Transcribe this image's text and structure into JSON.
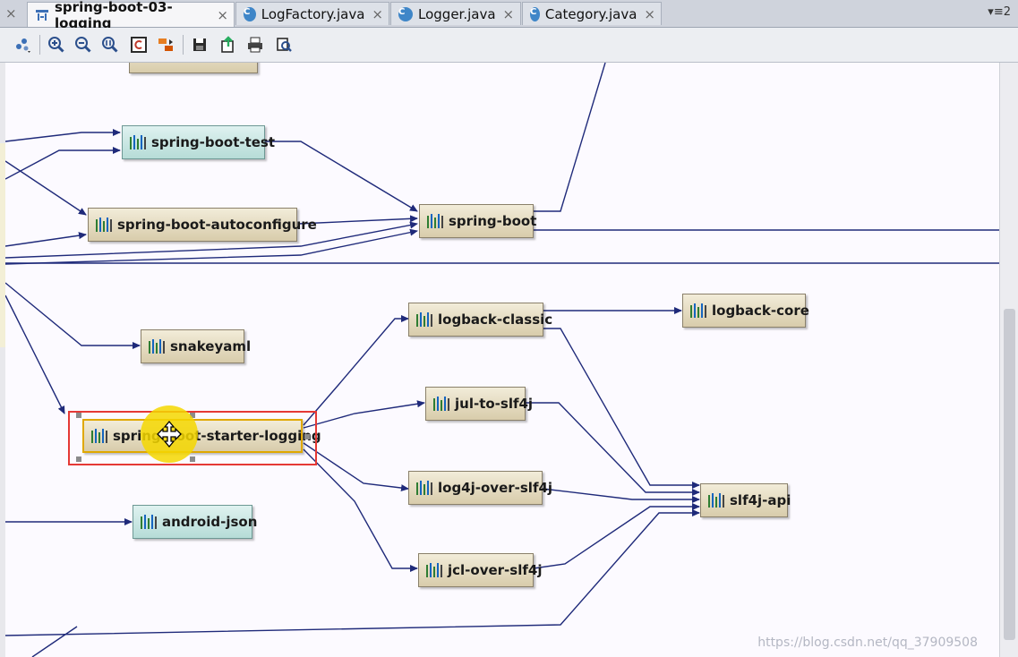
{
  "tabs": [
    {
      "label": "spring-boot-03-logging",
      "icon": "diagram-icon",
      "active": true
    },
    {
      "label": "LogFactory.java",
      "icon": "class-icon",
      "active": false
    },
    {
      "label": "Logger.java",
      "icon": "class-icon",
      "active": false
    },
    {
      "label": "Category.java",
      "icon": "class-icon",
      "active": false
    }
  ],
  "tab_close_glyph": "×",
  "tab_menu_glyph": "▾≡2",
  "toolbar": {
    "icons": [
      "layout-icon",
      "zoom-in-icon",
      "zoom-out-icon",
      "actual-size-icon",
      "fit-content-icon",
      "apply-layout-icon",
      "save-icon",
      "export-icon",
      "print-icon",
      "print-preview-icon"
    ]
  },
  "nodes": {
    "top_partial": "",
    "spring_boot_test": "spring-boot-test",
    "spring_boot_autoconfigure": "spring-boot-autoconfigure",
    "spring_boot": "spring-boot",
    "snakeyaml": "snakeyaml",
    "logback_classic": "logback-classic",
    "logback_core": "logback-core",
    "jul_to_slf4j": "jul-to-slf4j",
    "spring_boot_starter_logging": "spring-boot-starter-logging",
    "log4j_over_slf4j": "log4j-over-slf4j",
    "slf4j_api": "slf4j-api",
    "android_json": "android-json",
    "jcl_over_slf4j": "jcl-over-slf4j"
  },
  "colors": {
    "edge": "#1f2a7a",
    "selection": "#e53935",
    "cursor_highlight": "#f5d700"
  },
  "watermark": "https://blog.csdn.net/qq_37909508"
}
